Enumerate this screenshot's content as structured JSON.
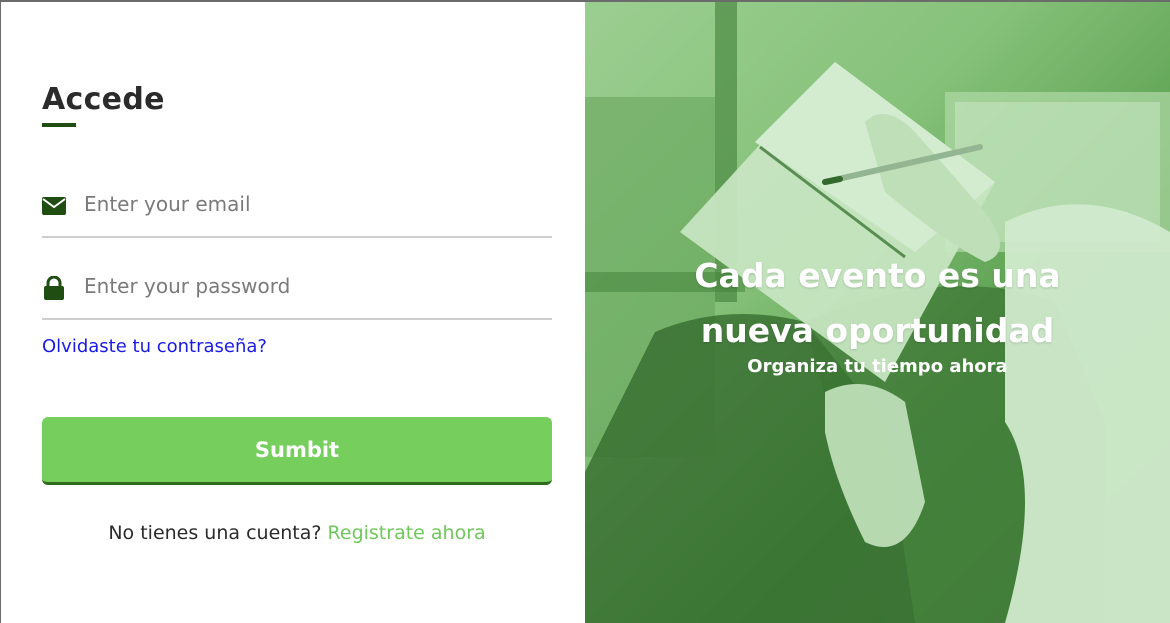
{
  "login": {
    "title": "Accede",
    "email_placeholder": "Enter your email",
    "password_placeholder": "Enter your password",
    "forgot_label": "Olvidaste tu contraseña?",
    "submit_label": "Sumbit",
    "signup_prompt": "No tienes una cuenta?",
    "signup_link": "Registrate ahora"
  },
  "hero": {
    "title": "Cada evento es una nueva oportunidad",
    "subtitle": "Organiza tu tiempo ahora"
  },
  "icons": {
    "email": "envelope-icon",
    "password": "lock-icon"
  },
  "colors": {
    "accent_green": "#76cf5d",
    "dark_green": "#1f4d12",
    "link_blue": "#1a1ae6",
    "signup_green": "#6fc85a"
  }
}
